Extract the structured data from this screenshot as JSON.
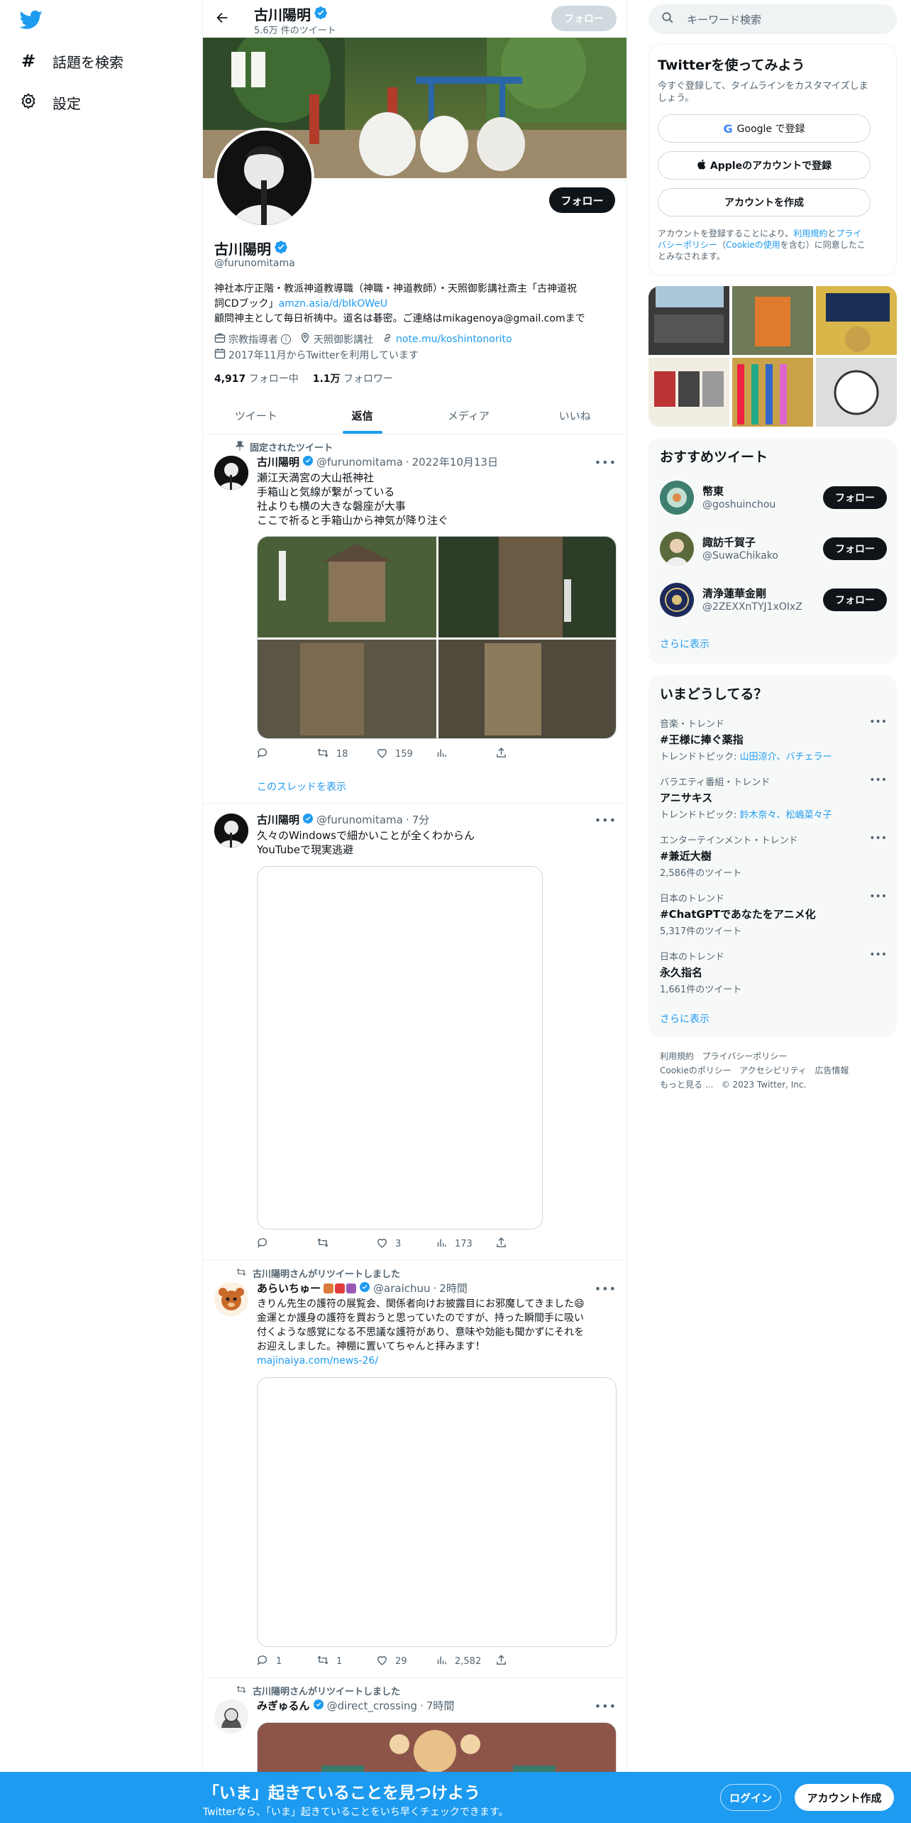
{
  "colors": {
    "accent": "#1d9bf0",
    "dark": "#0f1419",
    "muted": "#536471"
  },
  "nav": {
    "items": [
      {
        "label": "話題を検索",
        "icon": "hashtag-icon"
      },
      {
        "label": "設定",
        "icon": "gear-icon"
      }
    ]
  },
  "header": {
    "name": "古川陽明",
    "tweet_count": "5.6万 件のツイート",
    "follow_label": "フォロー"
  },
  "profile": {
    "name": "古川陽明",
    "handle": "@furunomitama",
    "follow_label": "フォロー",
    "bio_line1": "神社本庁正階・教派神道教導職（神職・神道教師）・天照御影講社斎主「古神道祝",
    "bio_line2a": "詞CDブック」",
    "bio_link": "amzn.asia/d/bIkOWeU",
    "bio_line3": "顧問神主として毎日祈祷中。道名は碁密。ご連絡はmikagenoya@gmail.comまで",
    "category": "宗教指導者",
    "location": "天照御影講社",
    "website": "note.mu/koshintonorito",
    "joined": "2017年11月からTwitterを利用しています",
    "following_count": "4,917",
    "following_label": "フォロー中",
    "followers_count": "1.1万",
    "followers_label": "フォロワー"
  },
  "tabs": [
    {
      "label": "ツイート"
    },
    {
      "label": "返信"
    },
    {
      "label": "メディア"
    },
    {
      "label": "いいね"
    }
  ],
  "tweets": [
    {
      "pinned_label": "固定されたツイート",
      "name": "古川陽明",
      "handle": "@furunomitama",
      "time": "2022年10月13日",
      "text": "瀬江天満宮の大山祇神社\n手箱山と気線が繋がっている\n社よりも横の大きな磐座が大事\nここで祈ると手箱山から神気が降り注ぐ",
      "replies": "",
      "retweets": "18",
      "likes": "159",
      "views": "",
      "thread_link": "このスレッドを表示"
    },
    {
      "name": "古川陽明",
      "handle": "@furunomitama",
      "time": "7分",
      "text": "久々のWindowsで細かいことが全くわからん\nYouTubeで現実逃避",
      "replies": "",
      "retweets": "",
      "likes": "3",
      "views": "173"
    },
    {
      "retweet_label": "古川陽明さんがリツイートしました",
      "name": "あらいちゅー",
      "handle": "@araichuu",
      "time": "2時間",
      "text": "きりん先生の護符の展覧会、関係者向けお披露目にお邪魔してきました😄\n金運とか護身の護符を買おうと思っていたのですが、持った瞬間手に吸い\n付くような感覚になる不思議な護符があり、意味や効能も聞かずにそれを\nお迎えしました。神棚に置いてちゃんと拝みます！",
      "link": "majinaiya.com/news-26/",
      "replies": "1",
      "retweets": "1",
      "likes": "29",
      "views": "2,582"
    },
    {
      "retweet_label": "古川陽明さんがリツイートしました",
      "name": "みぎゅるん",
      "handle": "@direct_crossing",
      "time": "7時間"
    }
  ],
  "right": {
    "search_placeholder": "キーワード検索",
    "signup": {
      "title": "Twitterを使ってみよう",
      "subtitle": "今すぐ登録して、タイムラインをカスタマイズしま\nしょう。",
      "google": "Google で登録",
      "apple": "Appleのアカウントで登録",
      "create": "アカウントを作成",
      "terms_a": "アカウントを登録することにより、",
      "terms_b": "利用規約",
      "terms_c": "と",
      "terms_d": "プライ\nバシーポリシー",
      "terms_e": "（",
      "terms_f": "Cookieの使用",
      "terms_g": "を含む）に同意したこ\nとみなされます。"
    },
    "whotofollow": {
      "title": "おすすめツイート",
      "follow_label": "フォロー",
      "show_more": "さらに表示",
      "users": [
        {
          "name": "幣東",
          "handle": "@goshuinchou"
        },
        {
          "name": "諏訪千賀子",
          "handle": "@SuwaChikako"
        },
        {
          "name": "清浄蓮華金剛",
          "handle": "@2ZEXXnTYJ1xOIxZ"
        }
      ]
    },
    "trends": {
      "title": "いまどうしてる？",
      "show_more": "さらに表示",
      "items": [
        {
          "category": "音楽・トレンド",
          "title": "#王様に捧ぐ薬指",
          "sub_label": "トレンドトピック: ",
          "sub_links": "山田涼介、バチェラー"
        },
        {
          "category": "バラエティ番組・トレンド",
          "title": "アニサキス",
          "sub_label": "トレンドトピック: ",
          "sub_links": "鈴木奈々、松嶋菜々子"
        },
        {
          "category": "エンターテインメント・トレンド",
          "title": "#兼近大樹",
          "sub_label": "2,586件のツイート",
          "sub_links": ""
        },
        {
          "category": "日本のトレンド",
          "title": "#ChatGPTであなたをアニメ化",
          "sub_label": "5,317件のツイート",
          "sub_links": ""
        },
        {
          "category": "日本のトレンド",
          "title": "永久指名",
          "sub_label": "1,661件のツイート",
          "sub_links": ""
        }
      ]
    },
    "footer": {
      "l1": "利用規約",
      "l2": "プライバシーポリシー",
      "l3": "Cookieのポリシー",
      "l4": "アクセシビリティ",
      "l5": "広告情報",
      "l6": "もっと見る ...",
      "copy": "© 2023 Twitter, Inc."
    }
  },
  "bottom_bar": {
    "title": "「いま」起きていることを見つけよう",
    "subtitle": "Twitterなら、「いま」起きていることをいち早くチェックできます。",
    "login": "ログイン",
    "signup": "アカウント作成"
  }
}
